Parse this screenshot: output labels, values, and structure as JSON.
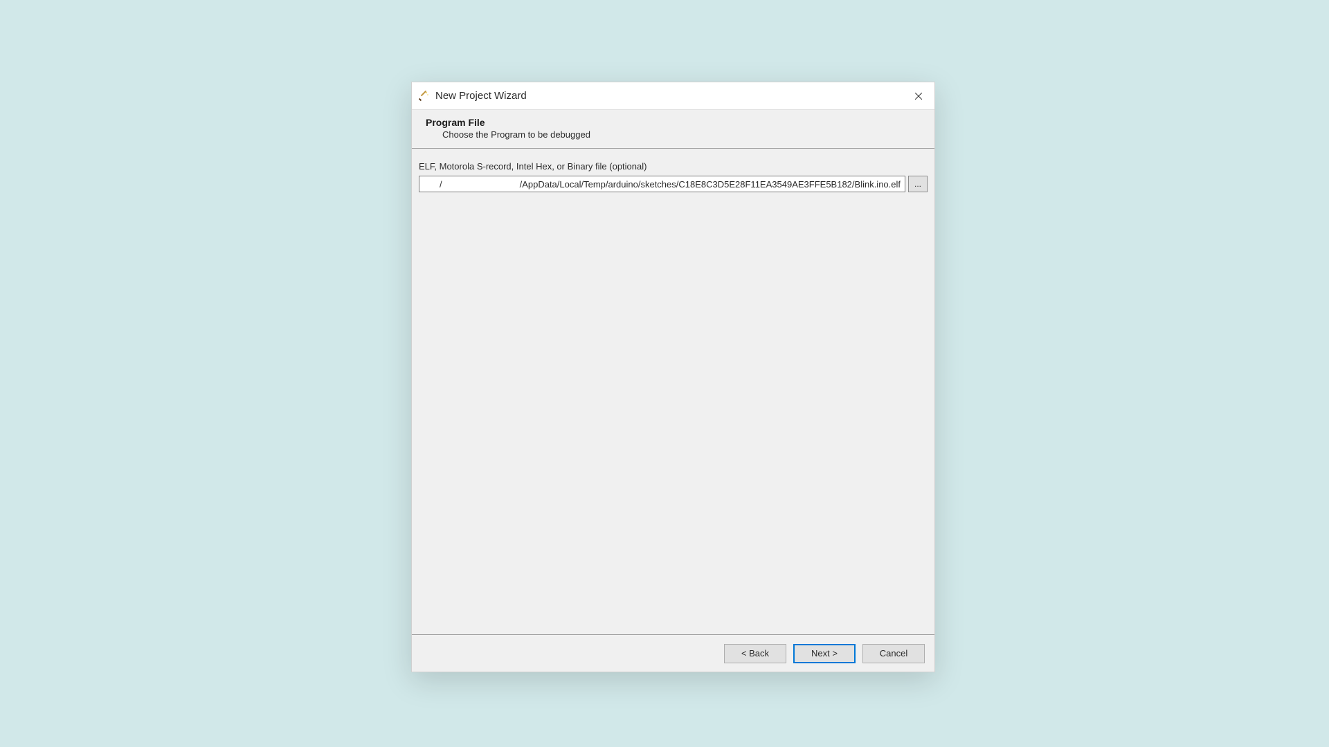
{
  "titlebar": {
    "title": "New Project Wizard"
  },
  "header": {
    "title": "Program File",
    "subtitle": "Choose the Program to be debugged"
  },
  "content": {
    "field_label": "ELF, Motorola S-record, Intel Hex, or Binary file (optional)",
    "path_value": "/                               /AppData/Local/Temp/arduino/sketches/C18E8C3D5E28F11EA3549AE3FFE5B182/Blink.ino.elf",
    "browse_label": "..."
  },
  "footer": {
    "back_label": "< Back",
    "next_label": "Next >",
    "cancel_label": "Cancel"
  }
}
